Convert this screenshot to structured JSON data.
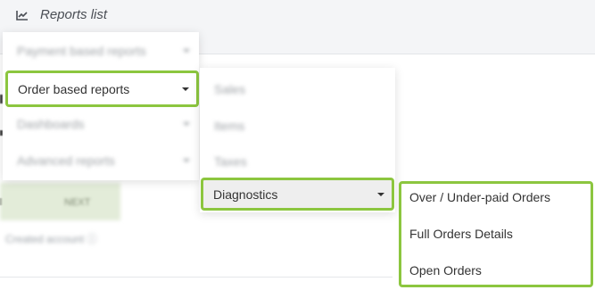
{
  "header": {
    "title": "Reports list",
    "icon": "line-chart-icon"
  },
  "menu_level1": {
    "items": [
      {
        "label": "Payment based reports",
        "state": "blurred"
      },
      {
        "label": "Order based reports",
        "state": "highlighted"
      },
      {
        "label": "Dashboards",
        "state": "blurred"
      },
      {
        "label": "Advanced reports",
        "state": "blurred"
      }
    ]
  },
  "menu_level2": {
    "items": [
      {
        "label": "Sales",
        "state": "blurred"
      },
      {
        "label": "Items",
        "state": "blurred"
      },
      {
        "label": "Taxes",
        "state": "blurred"
      },
      {
        "label": "Diagnostics",
        "state": "highlighted"
      }
    ]
  },
  "menu_level3": {
    "items": [
      {
        "label": "Over / Under-paid Orders"
      },
      {
        "label": "Full Orders Details"
      },
      {
        "label": "Open Orders"
      }
    ]
  },
  "background": {
    "button_label": "NEXT",
    "footer_text": "Created account"
  },
  "colors": {
    "highlight": "#8cc63f",
    "header_bg": "#f4f5f7",
    "selected_bg": "#eeeeee"
  }
}
